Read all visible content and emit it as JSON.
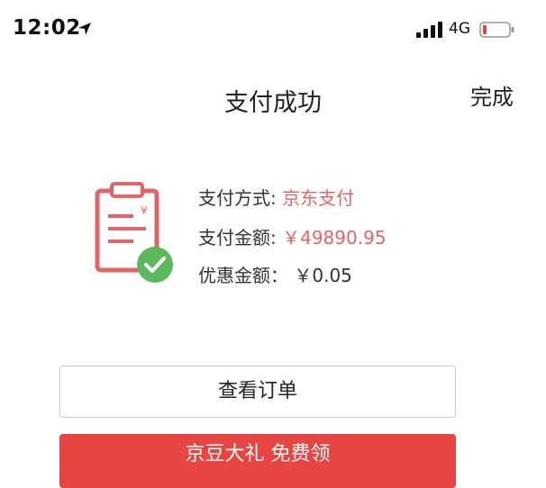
{
  "status_bar": {
    "time": "12:02",
    "network": "4G"
  },
  "nav": {
    "title": "支付成功",
    "done_label": "完成"
  },
  "payment": {
    "method_label": "支付方式:",
    "method_value": "京东支付",
    "amount_label": "支付金额:",
    "amount_value": "￥49890.95",
    "discount_label": "优惠金额：",
    "discount_value": "￥0.05"
  },
  "actions": {
    "view_order_label": "查看订单",
    "promo_label": "京豆大礼 免费领"
  },
  "colors": {
    "accent_red": "#e64541",
    "value_red": "#e06666",
    "success_green": "#5cb85c"
  }
}
